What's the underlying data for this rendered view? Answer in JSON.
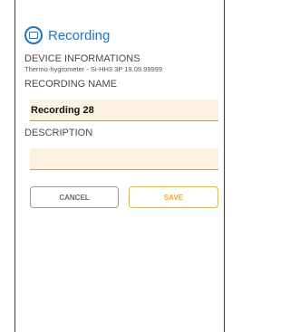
{
  "header": {
    "icon": "recording-icon",
    "title": "Recording"
  },
  "device": {
    "label": "DEVICE INFORMATIONS",
    "value": "Thermo-hygrometer - Si-HH3 3P 19.09.99999"
  },
  "recording_name": {
    "label": "RECORDING NAME",
    "value": "Recording 28"
  },
  "description": {
    "label": "DESCRIPTION",
    "value": ""
  },
  "actions": {
    "cancel_label": "CANCEL",
    "save_label": "SAVE"
  },
  "colors": {
    "accent_blue": "#1a76c4",
    "field_background": "#fdf1df",
    "save_orange": "#f5a623"
  }
}
